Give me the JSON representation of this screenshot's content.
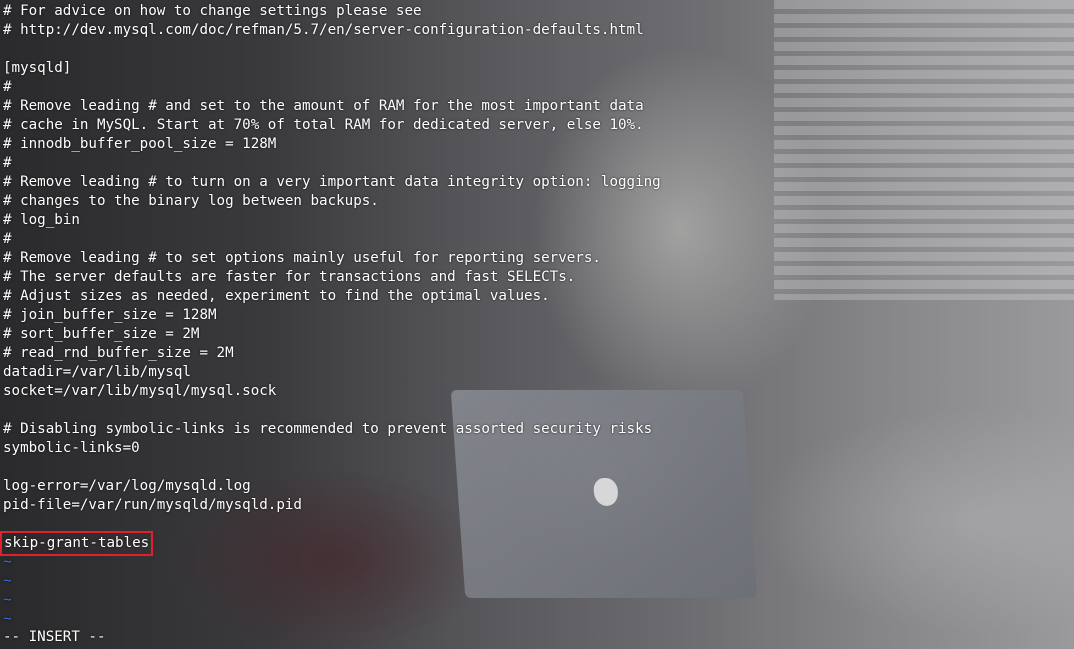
{
  "editor": {
    "lines": [
      "# For advice on how to change settings please see",
      "# http://dev.mysql.com/doc/refman/5.7/en/server-configuration-defaults.html",
      "",
      "[mysqld]",
      "#",
      "# Remove leading # and set to the amount of RAM for the most important data",
      "# cache in MySQL. Start at 70% of total RAM for dedicated server, else 10%.",
      "# innodb_buffer_pool_size = 128M",
      "#",
      "# Remove leading # to turn on a very important data integrity option: logging",
      "# changes to the binary log between backups.",
      "# log_bin",
      "#",
      "# Remove leading # to set options mainly useful for reporting servers.",
      "# The server defaults are faster for transactions and fast SELECTs.",
      "# Adjust sizes as needed, experiment to find the optimal values.",
      "# join_buffer_size = 128M",
      "# sort_buffer_size = 2M",
      "# read_rnd_buffer_size = 2M",
      "datadir=/var/lib/mysql",
      "socket=/var/lib/mysql/mysql.sock",
      "",
      "# Disabling symbolic-links is recommended to prevent assorted security risks",
      "symbolic-links=0",
      "",
      "log-error=/var/log/mysqld.log",
      "pid-file=/var/run/mysqld/mysqld.pid",
      ""
    ],
    "highlighted_line": "skip-grant-tables",
    "empty_line_markers": [
      "~",
      "~",
      "~",
      "~"
    ],
    "mode_indicator": "-- INSERT --"
  },
  "colors": {
    "text": "#ffffff",
    "tilde": "#3a6fd8",
    "highlight_box": "#e0202a"
  }
}
